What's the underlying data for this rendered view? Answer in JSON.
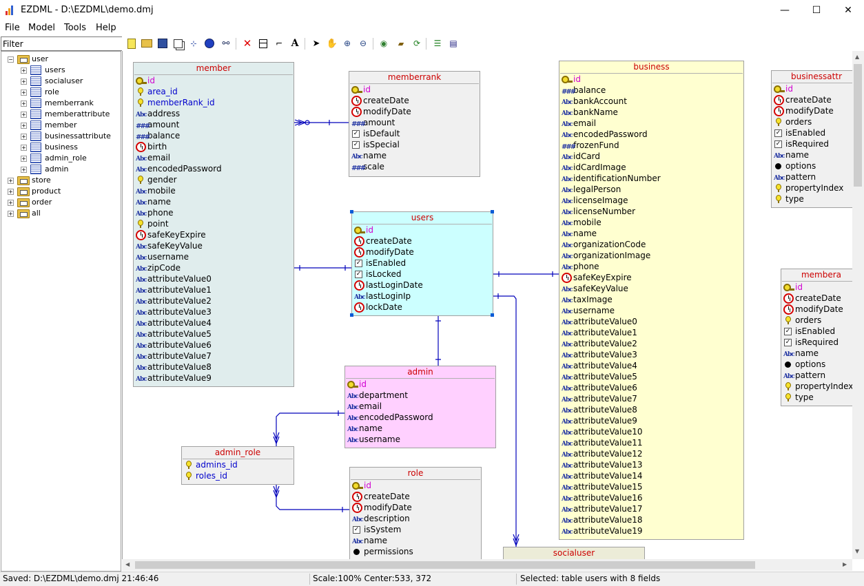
{
  "window": {
    "title": "EZDML - D:\\EZDML\\demo.dmj",
    "minimize_label": "—",
    "maximize_label": "☐",
    "close_label": "✕"
  },
  "menu": [
    {
      "label": "File"
    },
    {
      "label": "Model"
    },
    {
      "label": "Tools"
    },
    {
      "label": "Help"
    }
  ],
  "sidebar": {
    "filter_value": "Filter",
    "tree": [
      {
        "label": "user",
        "type": "folder",
        "level": 0,
        "expanded": true
      },
      {
        "label": "users",
        "type": "table",
        "level": 1
      },
      {
        "label": "socialuser",
        "type": "table",
        "level": 1
      },
      {
        "label": "role",
        "type": "table",
        "level": 1
      },
      {
        "label": "memberrank",
        "type": "table",
        "level": 1
      },
      {
        "label": "memberattribute",
        "type": "table",
        "level": 1
      },
      {
        "label": "member",
        "type": "table",
        "level": 1
      },
      {
        "label": "businessattribute",
        "type": "table",
        "level": 1
      },
      {
        "label": "business",
        "type": "table",
        "level": 1
      },
      {
        "label": "admin_role",
        "type": "table",
        "level": 1
      },
      {
        "label": "admin",
        "type": "table",
        "level": 1
      },
      {
        "label": "store",
        "type": "folder",
        "level": 0,
        "expanded": false
      },
      {
        "label": "product",
        "type": "folder",
        "level": 0,
        "expanded": false
      },
      {
        "label": "order",
        "type": "folder",
        "level": 0,
        "expanded": false
      },
      {
        "label": "all",
        "type": "folder",
        "level": 0,
        "expanded": false
      }
    ]
  },
  "toolbar": {
    "buttons": [
      "new-icon",
      "open-icon",
      "save-icon",
      "copy-icon",
      "tree-icon",
      "globe-icon",
      "binoculars-icon",
      "delete-icon",
      "table-icon",
      "link-icon",
      "text-icon",
      "pointer-icon",
      "hand-icon",
      "zoom-in-icon",
      "zoom-out-icon",
      "eye-icon",
      "car-icon",
      "refresh-icon",
      "add-field-icon",
      "properties-icon"
    ],
    "text_glyph": "A"
  },
  "colors": {
    "member": "#e0eded",
    "memberrank": "#f0f0f0",
    "users": "#ccffff",
    "admin": "#ffd0ff",
    "admin_role": "#f0f0f0",
    "role": "#f0f0f0",
    "business": "#ffffd0",
    "socialuser": "#ececd8",
    "businessattribute": "#f0f0f0",
    "memberattribute": "#f0f0f0",
    "title_text": "#cc0000",
    "relation_line": "#0000bb"
  },
  "entities": [
    {
      "id": "member",
      "title": "member",
      "fields": [
        {
          "name": "id",
          "type": "pk"
        },
        {
          "name": "area_id",
          "type": "fk"
        },
        {
          "name": "memberRank_id",
          "type": "fk"
        },
        {
          "name": "address",
          "type": "str"
        },
        {
          "name": "amount",
          "type": "num"
        },
        {
          "name": "balance",
          "type": "num"
        },
        {
          "name": "birth",
          "type": "date"
        },
        {
          "name": "email",
          "type": "str"
        },
        {
          "name": "encodedPassword",
          "type": "str"
        },
        {
          "name": "gender",
          "type": "int"
        },
        {
          "name": "mobile",
          "type": "str"
        },
        {
          "name": "name",
          "type": "str"
        },
        {
          "name": "phone",
          "type": "str"
        },
        {
          "name": "point",
          "type": "int"
        },
        {
          "name": "safeKeyExpire",
          "type": "date"
        },
        {
          "name": "safeKeyValue",
          "type": "str"
        },
        {
          "name": "username",
          "type": "str"
        },
        {
          "name": "zipCode",
          "type": "str"
        },
        {
          "name": "attributeValue0",
          "type": "str"
        },
        {
          "name": "attributeValue1",
          "type": "str"
        },
        {
          "name": "attributeValue2",
          "type": "str"
        },
        {
          "name": "attributeValue3",
          "type": "str"
        },
        {
          "name": "attributeValue4",
          "type": "str"
        },
        {
          "name": "attributeValue5",
          "type": "str"
        },
        {
          "name": "attributeValue6",
          "type": "str"
        },
        {
          "name": "attributeValue7",
          "type": "str"
        },
        {
          "name": "attributeValue8",
          "type": "str"
        },
        {
          "name": "attributeValue9",
          "type": "str"
        }
      ]
    },
    {
      "id": "memberrank",
      "title": "memberrank",
      "fields": [
        {
          "name": "id",
          "type": "pk"
        },
        {
          "name": "createDate",
          "type": "date"
        },
        {
          "name": "modifyDate",
          "type": "date"
        },
        {
          "name": "amount",
          "type": "num"
        },
        {
          "name": "isDefault",
          "type": "bool"
        },
        {
          "name": "isSpecial",
          "type": "bool"
        },
        {
          "name": "name",
          "type": "str"
        },
        {
          "name": "scale",
          "type": "num"
        }
      ]
    },
    {
      "id": "users",
      "title": "users",
      "fields": [
        {
          "name": "id",
          "type": "pk"
        },
        {
          "name": "createDate",
          "type": "date"
        },
        {
          "name": "modifyDate",
          "type": "date"
        },
        {
          "name": "isEnabled",
          "type": "bool"
        },
        {
          "name": "isLocked",
          "type": "bool"
        },
        {
          "name": "lastLoginDate",
          "type": "date"
        },
        {
          "name": "lastLoginIp",
          "type": "str"
        },
        {
          "name": "lockDate",
          "type": "date"
        }
      ]
    },
    {
      "id": "admin",
      "title": "admin",
      "fields": [
        {
          "name": "id",
          "type": "pk"
        },
        {
          "name": "department",
          "type": "str"
        },
        {
          "name": "email",
          "type": "str"
        },
        {
          "name": "encodedPassword",
          "type": "str"
        },
        {
          "name": "name",
          "type": "str"
        },
        {
          "name": "username",
          "type": "str"
        }
      ]
    },
    {
      "id": "admin_role",
      "title": "admin_role",
      "fields": [
        {
          "name": "admins_id",
          "type": "fk"
        },
        {
          "name": "roles_id",
          "type": "fk"
        }
      ]
    },
    {
      "id": "role",
      "title": "role",
      "fields": [
        {
          "name": "id",
          "type": "pk"
        },
        {
          "name": "createDate",
          "type": "date"
        },
        {
          "name": "modifyDate",
          "type": "date"
        },
        {
          "name": "description",
          "type": "str"
        },
        {
          "name": "isSystem",
          "type": "bool"
        },
        {
          "name": "name",
          "type": "str"
        },
        {
          "name": "permissions",
          "type": "obj"
        }
      ]
    },
    {
      "id": "business",
      "title": "business",
      "fields": [
        {
          "name": "id",
          "type": "pk"
        },
        {
          "name": "balance",
          "type": "num"
        },
        {
          "name": "bankAccount",
          "type": "str"
        },
        {
          "name": "bankName",
          "type": "str"
        },
        {
          "name": "email",
          "type": "str"
        },
        {
          "name": "encodedPassword",
          "type": "str"
        },
        {
          "name": "frozenFund",
          "type": "num"
        },
        {
          "name": "idCard",
          "type": "str"
        },
        {
          "name": "idCardImage",
          "type": "str"
        },
        {
          "name": "identificationNumber",
          "type": "str"
        },
        {
          "name": "legalPerson",
          "type": "str"
        },
        {
          "name": "licenseImage",
          "type": "str"
        },
        {
          "name": "licenseNumber",
          "type": "str"
        },
        {
          "name": "mobile",
          "type": "str"
        },
        {
          "name": "name",
          "type": "str"
        },
        {
          "name": "organizationCode",
          "type": "str"
        },
        {
          "name": "organizationImage",
          "type": "str"
        },
        {
          "name": "phone",
          "type": "str"
        },
        {
          "name": "safeKeyExpire",
          "type": "date"
        },
        {
          "name": "safeKeyValue",
          "type": "str"
        },
        {
          "name": "taxImage",
          "type": "str"
        },
        {
          "name": "username",
          "type": "str"
        },
        {
          "name": "attributeValue0",
          "type": "str"
        },
        {
          "name": "attributeValue1",
          "type": "str"
        },
        {
          "name": "attributeValue2",
          "type": "str"
        },
        {
          "name": "attributeValue3",
          "type": "str"
        },
        {
          "name": "attributeValue4",
          "type": "str"
        },
        {
          "name": "attributeValue5",
          "type": "str"
        },
        {
          "name": "attributeValue6",
          "type": "str"
        },
        {
          "name": "attributeValue7",
          "type": "str"
        },
        {
          "name": "attributeValue8",
          "type": "str"
        },
        {
          "name": "attributeValue9",
          "type": "str"
        },
        {
          "name": "attributeValue10",
          "type": "str"
        },
        {
          "name": "attributeValue11",
          "type": "str"
        },
        {
          "name": "attributeValue12",
          "type": "str"
        },
        {
          "name": "attributeValue13",
          "type": "str"
        },
        {
          "name": "attributeValue14",
          "type": "str"
        },
        {
          "name": "attributeValue15",
          "type": "str"
        },
        {
          "name": "attributeValue16",
          "type": "str"
        },
        {
          "name": "attributeValue17",
          "type": "str"
        },
        {
          "name": "attributeValue18",
          "type": "str"
        },
        {
          "name": "attributeValue19",
          "type": "str"
        }
      ]
    },
    {
      "id": "businessattribute",
      "title": "businessattr",
      "fields": [
        {
          "name": "id",
          "type": "pk"
        },
        {
          "name": "createDate",
          "type": "date"
        },
        {
          "name": "modifyDate",
          "type": "date"
        },
        {
          "name": "orders",
          "type": "int"
        },
        {
          "name": "isEnabled",
          "type": "bool"
        },
        {
          "name": "isRequired",
          "type": "bool"
        },
        {
          "name": "name",
          "type": "str"
        },
        {
          "name": "options",
          "type": "obj"
        },
        {
          "name": "pattern",
          "type": "str"
        },
        {
          "name": "propertyIndex",
          "type": "int"
        },
        {
          "name": "type",
          "type": "int"
        }
      ]
    },
    {
      "id": "memberattribute",
      "title": "membera",
      "fields": [
        {
          "name": "id",
          "type": "pk"
        },
        {
          "name": "createDate",
          "type": "date"
        },
        {
          "name": "modifyDate",
          "type": "date"
        },
        {
          "name": "orders",
          "type": "int"
        },
        {
          "name": "isEnabled",
          "type": "bool"
        },
        {
          "name": "isRequired",
          "type": "bool"
        },
        {
          "name": "name",
          "type": "str"
        },
        {
          "name": "options",
          "type": "obj"
        },
        {
          "name": "pattern",
          "type": "str"
        },
        {
          "name": "propertyIndex",
          "type": "int"
        },
        {
          "name": "type",
          "type": "int"
        }
      ]
    },
    {
      "id": "socialuser",
      "title": "socialuser",
      "fields": []
    }
  ],
  "status": {
    "saved": "Saved: D:\\EZDML\\demo.dmj 21:46:46",
    "scale": "Scale:100% Center:533, 372",
    "selected": "Selected: table users with 8 fields"
  }
}
